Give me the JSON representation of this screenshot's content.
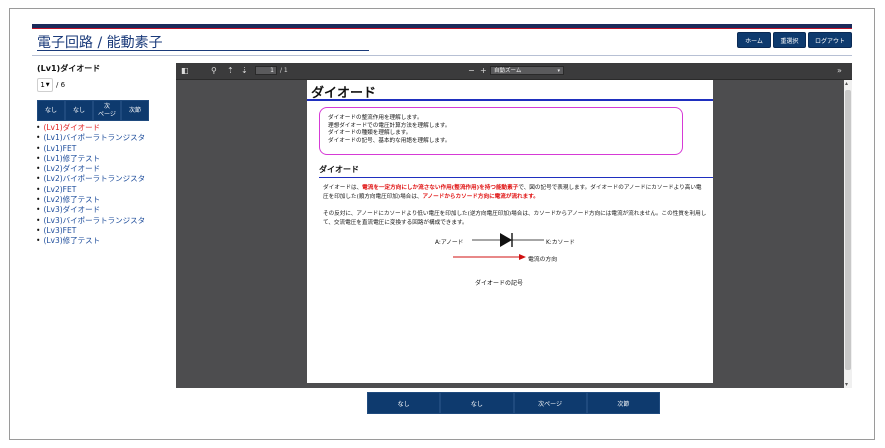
{
  "app": {
    "title": "電子回路 / 能動素子"
  },
  "header": {
    "home_label": "ホーム",
    "reselect_label": "重選択",
    "logout_label": "ログアウト"
  },
  "sidebar": {
    "title": "(Lv1)ダイオード",
    "page_value": "1",
    "page_total": "/ 6",
    "buttons": [
      "なし",
      "なし",
      "次\nページ",
      "次節"
    ],
    "items": [
      {
        "label": "(Lv1)ダイオード",
        "active": true
      },
      {
        "label": "(Lv1)バイポーラトランジスタ",
        "active": false
      },
      {
        "label": "(Lv1)FET",
        "active": false
      },
      {
        "label": "(Lv1)修了テスト",
        "active": false
      },
      {
        "label": "(Lv2)ダイオード",
        "active": false
      },
      {
        "label": "(Lv2)バイポーラトランジスタ",
        "active": false
      },
      {
        "label": "(Lv2)FET",
        "active": false
      },
      {
        "label": "(Lv2)修了テスト",
        "active": false
      },
      {
        "label": "(Lv3)ダイオード",
        "active": false
      },
      {
        "label": "(Lv3)バイポーラトランジスタ",
        "active": false
      },
      {
        "label": "(Lv3)FET",
        "active": false
      },
      {
        "label": "(Lv3)修了テスト",
        "active": false
      }
    ]
  },
  "viewer": {
    "page_input": "1",
    "page_of": "/ 1",
    "zoom_label": "自動ズーム",
    "zoom_out": "−",
    "zoom_in": "+",
    "more": "»",
    "icons": [
      "sidebar-toggle-icon",
      "search-icon",
      "page-up-icon",
      "page-down-icon"
    ]
  },
  "pdf": {
    "heading": "ダイオード",
    "objectives": [
      "ダイオードの整流作用を理解します。",
      "理想ダイオードでの電圧計算方法を理解します。",
      "ダイオードの種類を理解します。",
      "ダイオードの記号、基本的な用語を理解します。"
    ],
    "section_heading": "ダイオード",
    "para1_a": "ダイオードは、",
    "para1_red1": "電流を一定方向にしか流さない作用(整流作用)を持つ能動素子",
    "para1_b": "で、図の記号で表現します。ダイオードのアノードにカソードより高い電圧を印加した(順方向電圧印加)場合は、",
    "para1_red2": "アノードからカソード方向に電流が流れます。",
    "para2": "その反対に、アノードにカソードより低い電圧を印加した(逆方向電圧印加)場合は、カソードからアノード方向には電流が流れません。この性質を利用して、交流電圧を直流電圧に変換する回路が構成できます。",
    "anode_label": "A:アノード",
    "cathode_label": "K:カソード",
    "current_label": "電流の方向",
    "caption": "ダイオードの記号"
  },
  "bottom_nav": [
    "なし",
    "なし",
    "次ページ",
    "次節"
  ],
  "colors": {
    "navy": "#0e3a6e",
    "accent_red": "#c0142a",
    "link_blue": "#1a4a9a",
    "active_red": "#e02020"
  }
}
